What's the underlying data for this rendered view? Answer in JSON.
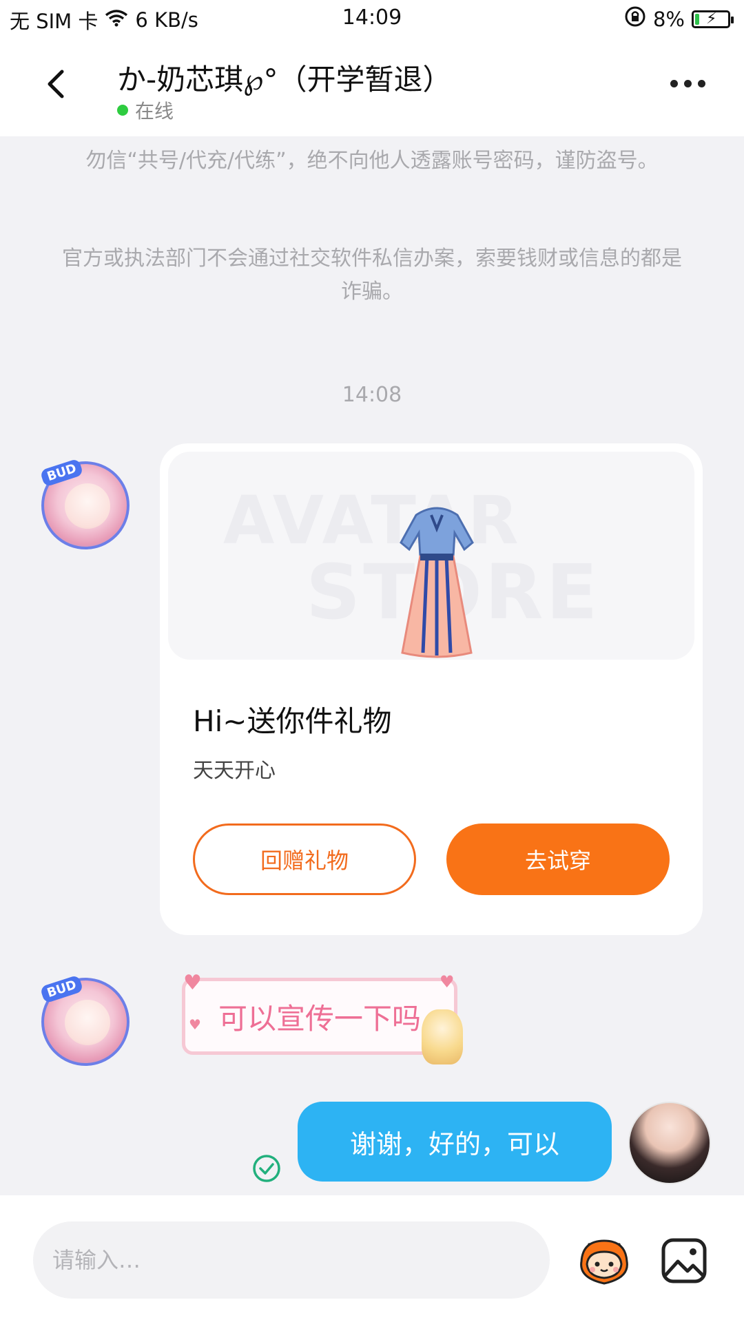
{
  "status_bar": {
    "carrier": "无 SIM 卡",
    "speed": "6 KB/s",
    "time": "14:09",
    "battery": "8%"
  },
  "header": {
    "title": "か-奶芯琪℘°（开学暂退）",
    "status": "在线"
  },
  "notices": [
    "勿信“共号/代充/代练”，绝不向他人透露账号密码，谨防盗号。",
    "官方或执法部门不会通过社交软件私信办案，索要钱财或信息的都是诈骗。"
  ],
  "time_divider": "14:08",
  "gift_card": {
    "watermark_line1": "AVATAR",
    "watermark_line2": "STORE",
    "title": "Hi~送你件礼物",
    "subtitle": "天天开心",
    "return_button": "回赠礼物",
    "try_button": "去试穿"
  },
  "sticker": {
    "text": "可以宣传一下吗"
  },
  "sent_message": {
    "text": "谢谢，好的，可以"
  },
  "input": {
    "placeholder": "请输入…"
  },
  "colors": {
    "accent_orange": "#f97316",
    "bubble_blue": "#2db3f3",
    "online_green": "#2ecc40"
  }
}
